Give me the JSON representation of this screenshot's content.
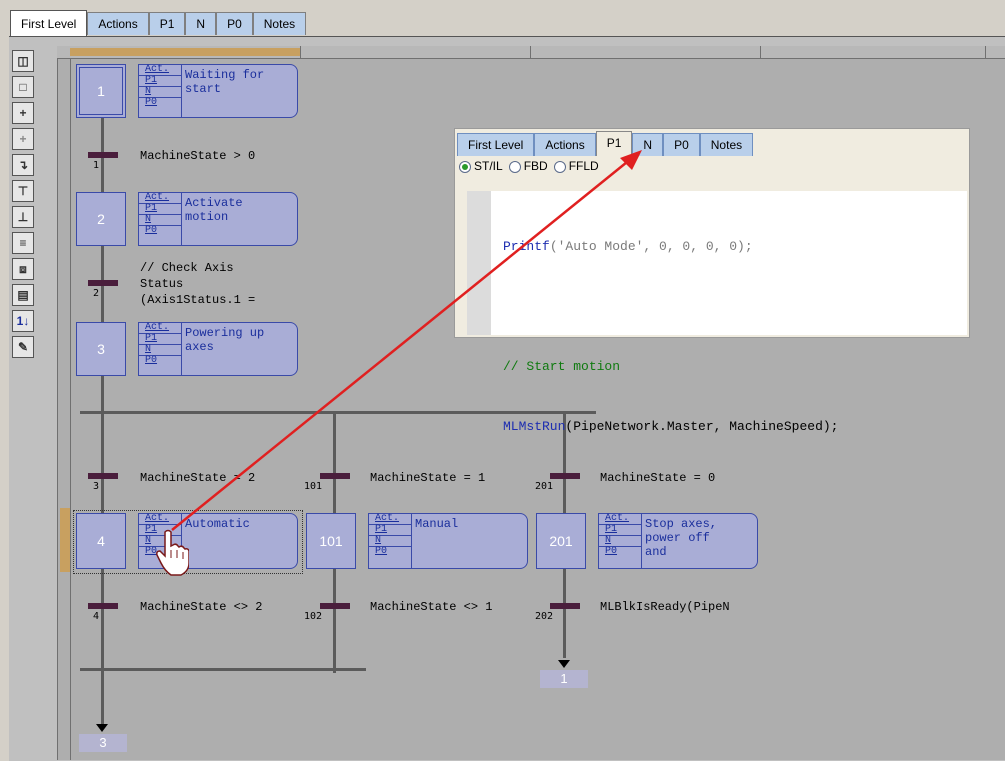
{
  "tabs": [
    "First Level",
    "Actions",
    "P1",
    "N",
    "P0",
    "Notes"
  ],
  "active_tab": "First Level",
  "toolbar_icons": [
    "initial-step-icon",
    "step-icon",
    "transition-icon",
    "transition-link-icon",
    "jump-icon",
    "divergence-icon",
    "convergence-icon",
    "parallel-icon",
    "macro-step-icon",
    "action-icon",
    "renumber-icon",
    "edit-icon"
  ],
  "action_qualifiers": [
    "Act.",
    "P1",
    "N",
    "P0"
  ],
  "steps": [
    {
      "num": "1",
      "text": "Waiting for\nstart"
    },
    {
      "num": "2",
      "text": "Activate\nmotion"
    },
    {
      "num": "3",
      "text": "Powering up\naxes"
    },
    {
      "num": "4",
      "text": "Automatic"
    },
    {
      "num": "101",
      "text": "Manual"
    },
    {
      "num": "201",
      "text": "Stop axes,\npower off\nand"
    }
  ],
  "transitions": [
    {
      "num": "1",
      "cond": "MachineState > 0"
    },
    {
      "num": "2",
      "cond": "// Check Axis\nStatus\n(Axis1Status.1 ="
    },
    {
      "num": "3",
      "cond": "MachineState = 2"
    },
    {
      "num": "101",
      "cond": "MachineState = 1"
    },
    {
      "num": "201",
      "cond": "MachineState = 0"
    },
    {
      "num": "4",
      "cond": "MachineState <> 2"
    },
    {
      "num": "102",
      "cond": "MachineState <> 1"
    },
    {
      "num": "202",
      "cond": "MLBlkIsReady(PipeN"
    }
  ],
  "jumps": [
    "3",
    "1"
  ],
  "popup": {
    "tabs": [
      "First Level",
      "Actions",
      "P1",
      "N",
      "P0",
      "Notes"
    ],
    "active_tab": "P1",
    "radio": [
      {
        "label": "ST/IL",
        "checked": true
      },
      {
        "label": "FBD",
        "checked": false
      },
      {
        "label": "FFLD",
        "checked": false
      }
    ],
    "code": {
      "line1_kw": "Printf",
      "line1_rest": "('Auto Mode', 0, 0, 0, 0);",
      "line2": "",
      "line3_comment": "// Start motion",
      "line4_kw": "MLMstRun",
      "line4_rest": "(PipeNetwork.Master, MachineSpeed);"
    }
  },
  "colors": {
    "step_fill": "#a9add6",
    "step_border": "#3a4aa8",
    "transition": "#4a1e3c",
    "arrow": "#e02020"
  }
}
